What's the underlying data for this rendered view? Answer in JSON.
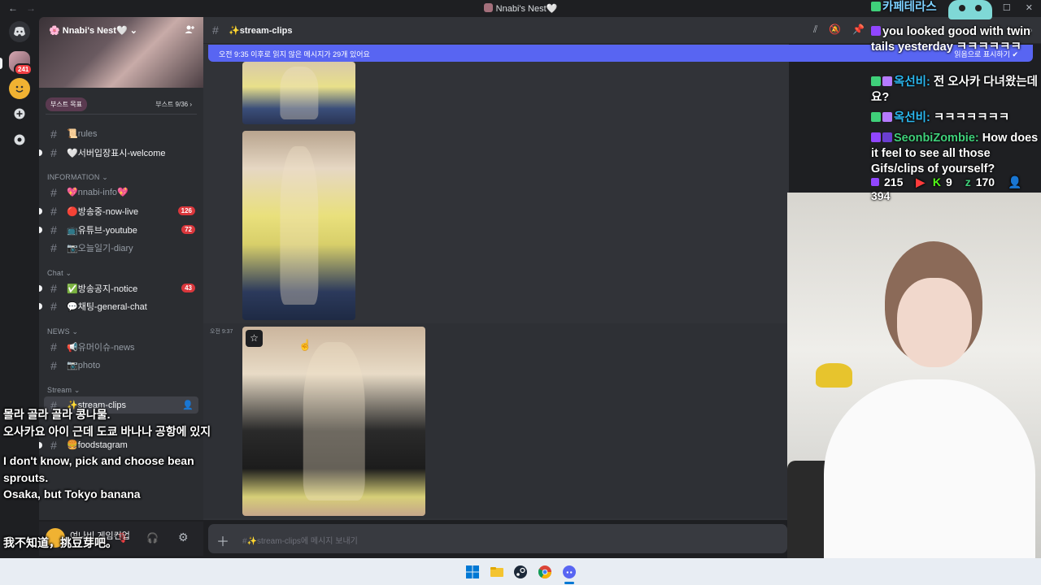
{
  "titlebar": {
    "title": "Nnabi's Nest🤍",
    "back": "←",
    "forward": "→"
  },
  "window_controls": {
    "minimize": "—",
    "maximize": "☐",
    "close": "✕"
  },
  "rail": {
    "dm_badge": "241"
  },
  "server": {
    "name": "Nnabi's Nest🤍 ⌄",
    "boost_goal": "부스트 목표",
    "boost_count": "부스트 9/36 ›"
  },
  "categories": {
    "information": "INFORMATION ⌄",
    "chat": "Chat ⌄",
    "news": "NEWS ⌄",
    "stream": "Stream ⌄"
  },
  "channels": [
    {
      "label": "📜rules",
      "count": ""
    },
    {
      "label": "🤍서버입장표시-welcome",
      "count": ""
    },
    {
      "label": "💖nnabi-info💖",
      "count": ""
    },
    {
      "label": "🔴방송중-now-live",
      "count": "126"
    },
    {
      "label": "📺유튜브-youtube",
      "count": "72"
    },
    {
      "label": "📷오늘일기-diary",
      "count": ""
    },
    {
      "label": "✅방송공지-notice",
      "count": "43"
    },
    {
      "label": "💬채팅-general-chat",
      "count": ""
    },
    {
      "label": "📢유머이슈-news",
      "count": ""
    },
    {
      "label": "📷photo",
      "count": ""
    },
    {
      "label": "✨stream-clips",
      "count": ""
    },
    {
      "label": "🍔foodstagram",
      "count": ""
    }
  ],
  "header": {
    "channel": "✨stream-clips"
  },
  "unread": {
    "message": "오전 9:35 이후로 읽지 않은 메시지가 29개 있어요",
    "mark_read": "읽음으로 표시하기 ✔"
  },
  "message": {
    "timestamp": "오전 9:37"
  },
  "composer": {
    "placeholder": "#✨stream-clips에 메시지 보내기"
  },
  "overlay_chat": {
    "lines": [
      {
        "user": "카페테라스",
        "text": "",
        "color": "#7dd0ff"
      },
      {
        "user": "",
        "text": "you looked good with twin tails yesterday ㅋㅋㅋㅋㅋㅋ",
        "color": "#ffffff"
      },
      {
        "user": "옥선비:",
        "text": "전 오사카 다녀왔는데요?",
        "color": "#2bb8f0"
      },
      {
        "user": "옥선비:",
        "text": "ㅋㅋㅋㅋㅋㅋㅋ",
        "color": "#2bb8f0"
      },
      {
        "user": "SeonbiZombie:",
        "text": "How does it feel to see all those Gifs/clips of yourself?",
        "color": "#3fd07a"
      }
    ],
    "stats": {
      "twitch": "215",
      "kick": "9",
      "other": "170",
      "viewers": "394"
    }
  },
  "subtitles": [
    "몰라 골라 골라 콩나물.",
    "오사카요 아이 근데 도쿄 바나나 공항에 있지",
    "I don't know, pick and choose bean",
    "sprouts.",
    "Osaka, but Tokyo banana",
    "我不知道，挑豆芽吧。"
  ],
  "user_area": {
    "status": "여나비 게임컨업"
  },
  "colors": {
    "accent": "#5865f2",
    "badge": "#da373c",
    "bg": "#313338",
    "sidebar": "#2b2d31"
  },
  "icons": [
    "discord-icon",
    "add-server-icon",
    "explore-icon",
    "hash-icon",
    "star-icon",
    "windows-start-icon",
    "file-explorer-icon",
    "steam-icon",
    "chrome-icon",
    "discord-taskbar-icon"
  ]
}
